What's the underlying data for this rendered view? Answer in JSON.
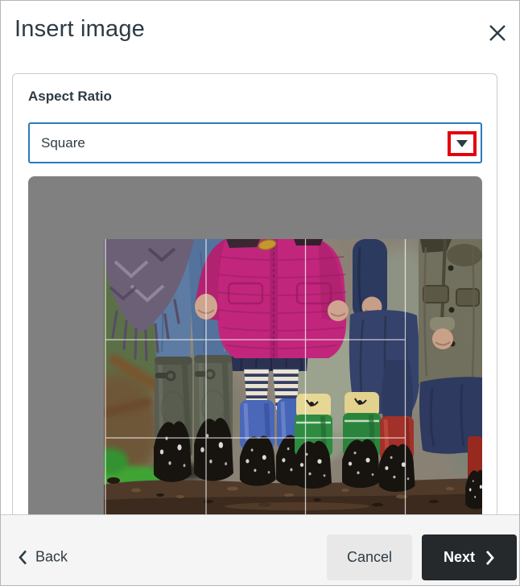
{
  "dialog": {
    "title": "Insert image"
  },
  "form": {
    "aspect_ratio_label": "Aspect Ratio",
    "aspect_ratio_value": "Square"
  },
  "preview": {
    "photo_description": "Four children standing on muddy ground in rain boots (olive, blue, green and red pairs), one in a pink puffer coat with striped tights; square crop with rule-of-thirds grid overlay"
  },
  "footer": {
    "back_label": "Back",
    "cancel_label": "Cancel",
    "next_label": "Next"
  },
  "colors": {
    "accent_blue": "#2B7ABC",
    "annotation_red": "#E4000F",
    "text_dark": "#2D3B45",
    "panel_border": "#C7CDD1",
    "preview_background": "#808080",
    "footer_background": "#F5F5F5",
    "cancel_button_background": "#E8E8E8",
    "next_button_background": "#25292B",
    "next_button_text": "#FFFFFF",
    "crop_grid_line": "#FFFFFF"
  }
}
